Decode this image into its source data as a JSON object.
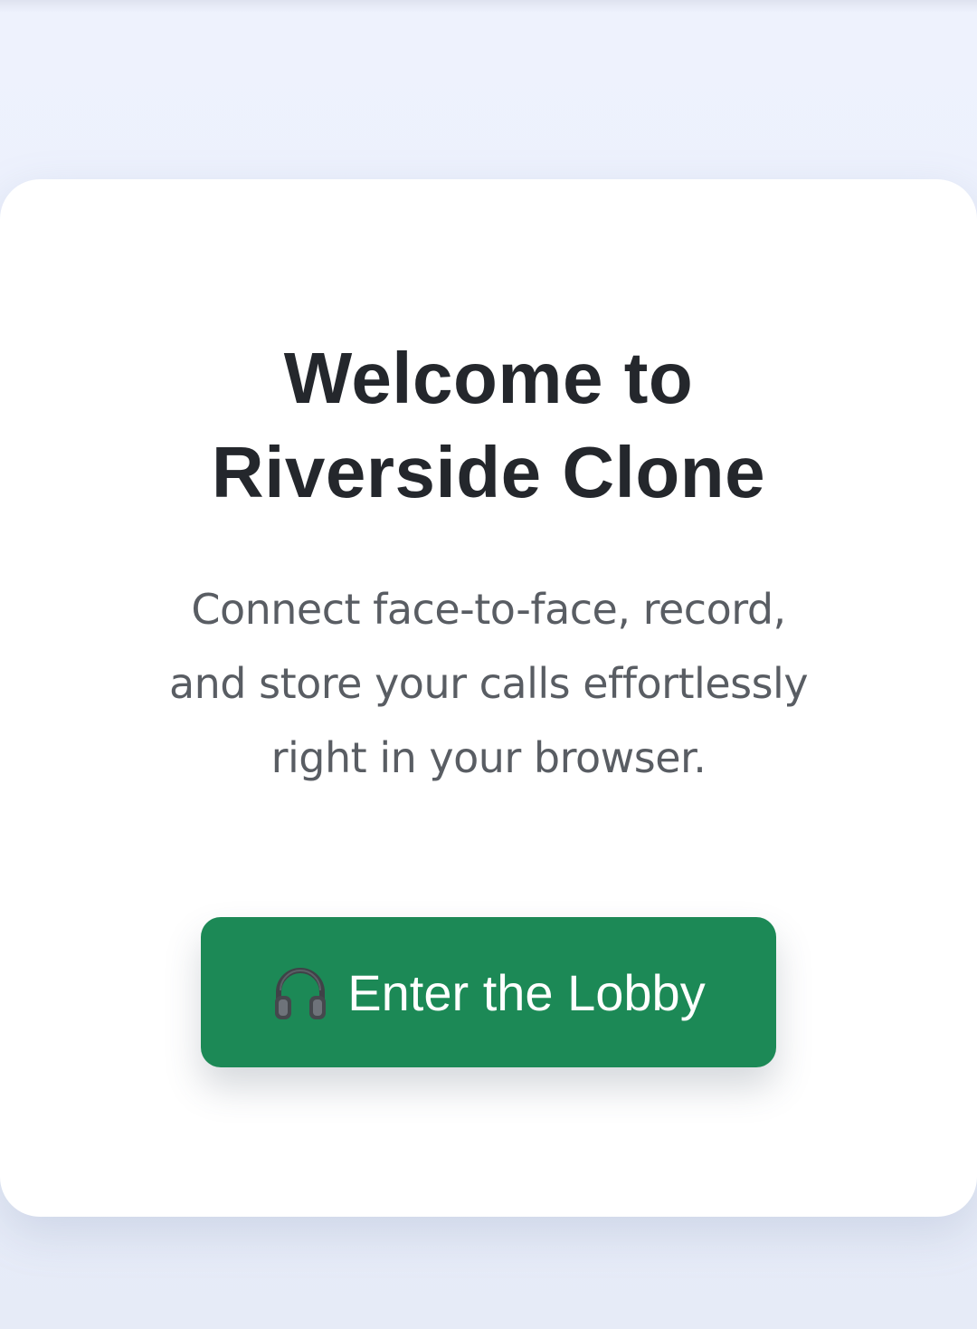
{
  "hero": {
    "title_line1": "Welcome to",
    "title_line2": "Riverside Clone",
    "subtitle_line1": "Connect face-to-face, record,",
    "subtitle_line2": "and store your calls effortlessly",
    "subtitle_line3": "right in your browser."
  },
  "cta": {
    "icon": "headphones-icon",
    "label": "Enter the Lobby",
    "color": "#1c8956"
  },
  "colors": {
    "background": "#eef2fd",
    "card": "#ffffff",
    "title": "#24272c",
    "subtitle": "#595d63"
  }
}
